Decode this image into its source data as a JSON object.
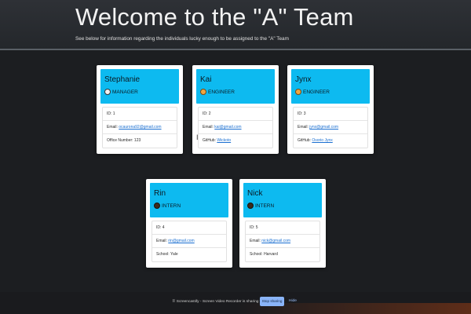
{
  "header": {
    "title": "Welcome to the \"A\" Team",
    "subtitle": "See below for information regarding the individuals lucky enough to be assigned to the \"A\" Team"
  },
  "cards": [
    {
      "name": "Stephanie",
      "role": "MANAGER",
      "role_icon": "coffee-cup-icon",
      "id": "ID: 1",
      "email_label": "Email: ",
      "email": "ocaurona92@gmail.com",
      "extra": "Office Number: 123"
    },
    {
      "name": "Kai",
      "role": "ENGINEER",
      "role_icon": "lightbulb-icon",
      "id": "ID: 2",
      "email_label": "Email: ",
      "email": "kai@gmail.com",
      "extra_label": "GitHub: ",
      "extra_link": "Wickoto"
    },
    {
      "name": "Jynx",
      "role": "ENGINEER",
      "role_icon": "lightbulb-icon",
      "id": "ID: 3",
      "email_label": "Email: ",
      "email": "jynx@gmail.com",
      "extra_label": "GitHub: ",
      "extra_link": "Osorio Jynx"
    },
    {
      "name": "Rin",
      "role": "INTERN",
      "role_icon": "graduation-cap-icon",
      "id": "ID: 4",
      "email_label": "Email: ",
      "email": "rin@gmail.com",
      "extra": "School: Yale"
    },
    {
      "name": "Nick",
      "role": "INTERN",
      "role_icon": "graduation-cap-icon",
      "id": "ID: 5",
      "email_label": "Email: ",
      "email": "nick@gmail.com",
      "extra": "School: Harvard"
    }
  ],
  "share_bar": {
    "icon": "pause-icon",
    "message": "Screencastify - Screen Video Recorder is sharing your screen.",
    "stop_label": "Stop sharing",
    "hide_label": "Hide"
  },
  "colors": {
    "background": "#1c1e21",
    "card_header": "#0dbaf0",
    "link": "#1a6fd1"
  }
}
